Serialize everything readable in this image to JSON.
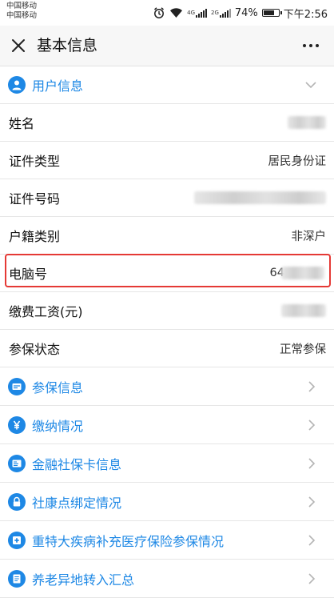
{
  "status_bar": {
    "carrier_1": "中国移动",
    "carrier_2": "中国移动",
    "network_1": "4G",
    "network_2": "2G",
    "battery": "74%",
    "battery_level": 0.74,
    "time": "下午2:56",
    "icons": [
      "alarm-icon",
      "wifi-icon",
      "signal-icon",
      "battery-icon"
    ]
  },
  "header": {
    "title": "基本信息",
    "close_icon": "close-icon",
    "more_icon": "more-icon"
  },
  "user_section": {
    "title": "用户信息",
    "icon": "user-icon",
    "toggle_icon": "chevron-down-icon"
  },
  "info_rows": [
    {
      "label": "姓名",
      "value": ""
    },
    {
      "label": "证件类型",
      "value": "居民身份证"
    },
    {
      "label": "证件号码",
      "value": ""
    },
    {
      "label": "户籍类别",
      "value": "非深户"
    },
    {
      "label": "电脑号",
      "value": "64"
    },
    {
      "label": "缴费工资(元)",
      "value": ""
    },
    {
      "label": "参保状态",
      "value": "正常参保"
    }
  ],
  "nav_items": [
    {
      "label": "参保信息",
      "icon": "card-icon"
    },
    {
      "label": "缴纳情况",
      "icon": "yuan-icon"
    },
    {
      "label": "金融社保卡信息",
      "icon": "id-card-icon"
    },
    {
      "label": "社康点绑定情况",
      "icon": "lock-icon"
    },
    {
      "label": "重特大疾病补充医疗保险参保情况",
      "icon": "medical-cross-icon"
    },
    {
      "label": "养老异地转入汇总",
      "icon": "document-icon"
    }
  ],
  "colors": {
    "accent": "#1e88e5",
    "highlight": "#e53935",
    "background": "#f4f4f4"
  }
}
